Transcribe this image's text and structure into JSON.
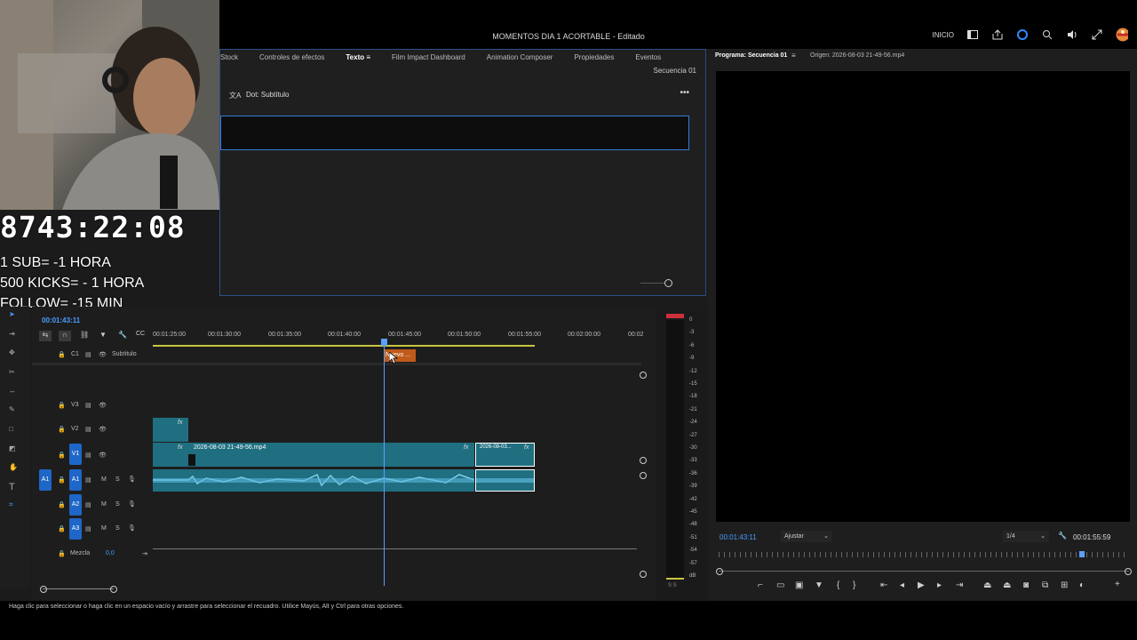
{
  "window": {
    "title": "MOMENTOS DIA 1 ACORTABLE - Editado",
    "workspace_label": "INICIO"
  },
  "effects_panel": {
    "tabs": [
      "Stock",
      "Controles de efectos",
      "Texto",
      "Film Impact Dashboard",
      "Animation Composer",
      "Propiedades",
      "Eventos"
    ],
    "active_tab": "Texto",
    "sequence": "Secuencia 01",
    "caption_item": "Dot: Subtítulo",
    "more": "•••"
  },
  "stream_overlay": {
    "timer": "8743:22:08",
    "lines": [
      "1 SUB= -1 HORA",
      "500 KICKS= - 1 HORA",
      "FOLLOW= -15 MIN"
    ]
  },
  "timeline": {
    "timecode": "00:01:43:11",
    "ruler": [
      "00:01:25:00",
      "00:01:30:00",
      "00:01:35:00",
      "00:01:40:00",
      "00:01:45:00",
      "00:01:50:00",
      "00:01:55:00",
      "00:02:00:00",
      "00:02"
    ],
    "caption_track": {
      "id": "C1",
      "name": "Subtítulo",
      "clip": "Nuevo ..."
    },
    "video_tracks": [
      "V3",
      "V2",
      "V1"
    ],
    "audio_tracks": [
      "A1",
      "A2",
      "A3"
    ],
    "source_patch_v": "V1",
    "source_patch_a": "A1",
    "clip_main": "2026-08-03 21-49-56.mp4",
    "clip_short": "2026-08-03...",
    "fx": "fx",
    "mix_label": "Mezcla",
    "mix_value": "0,0",
    "track_m": "M",
    "track_s": "S"
  },
  "meters": {
    "scale": [
      "0",
      "-3",
      "-6",
      "-9",
      "-12",
      "-15",
      "-18",
      "-21",
      "-24",
      "-27",
      "-30",
      "-33",
      "-36",
      "-39",
      "-42",
      "-45",
      "-48",
      "-51",
      "-54",
      "-57",
      "dB"
    ],
    "bottom": "S  S"
  },
  "program_monitor": {
    "tab_program": "Programa: Secuencia 01",
    "tab_source": "Origen: 2026-08-03 21-49-56.mp4",
    "timecode": "00:01:43:11",
    "fit": "Ajustar",
    "resolution": "1/4",
    "duration": "00:01:55:59"
  },
  "status_bar": {
    "text": "Haga clic para seleccionar o haga clic en un espacio vacío y arrastre para seleccionar el recuadro. Utilice Mayús, Alt y Ctrl para otras opciones."
  },
  "colors": {
    "accent": "#2e8bff",
    "clip_teal": "#1f6f80",
    "caption_clip": "#c05a1a",
    "playhead": "#5aa0ff"
  }
}
